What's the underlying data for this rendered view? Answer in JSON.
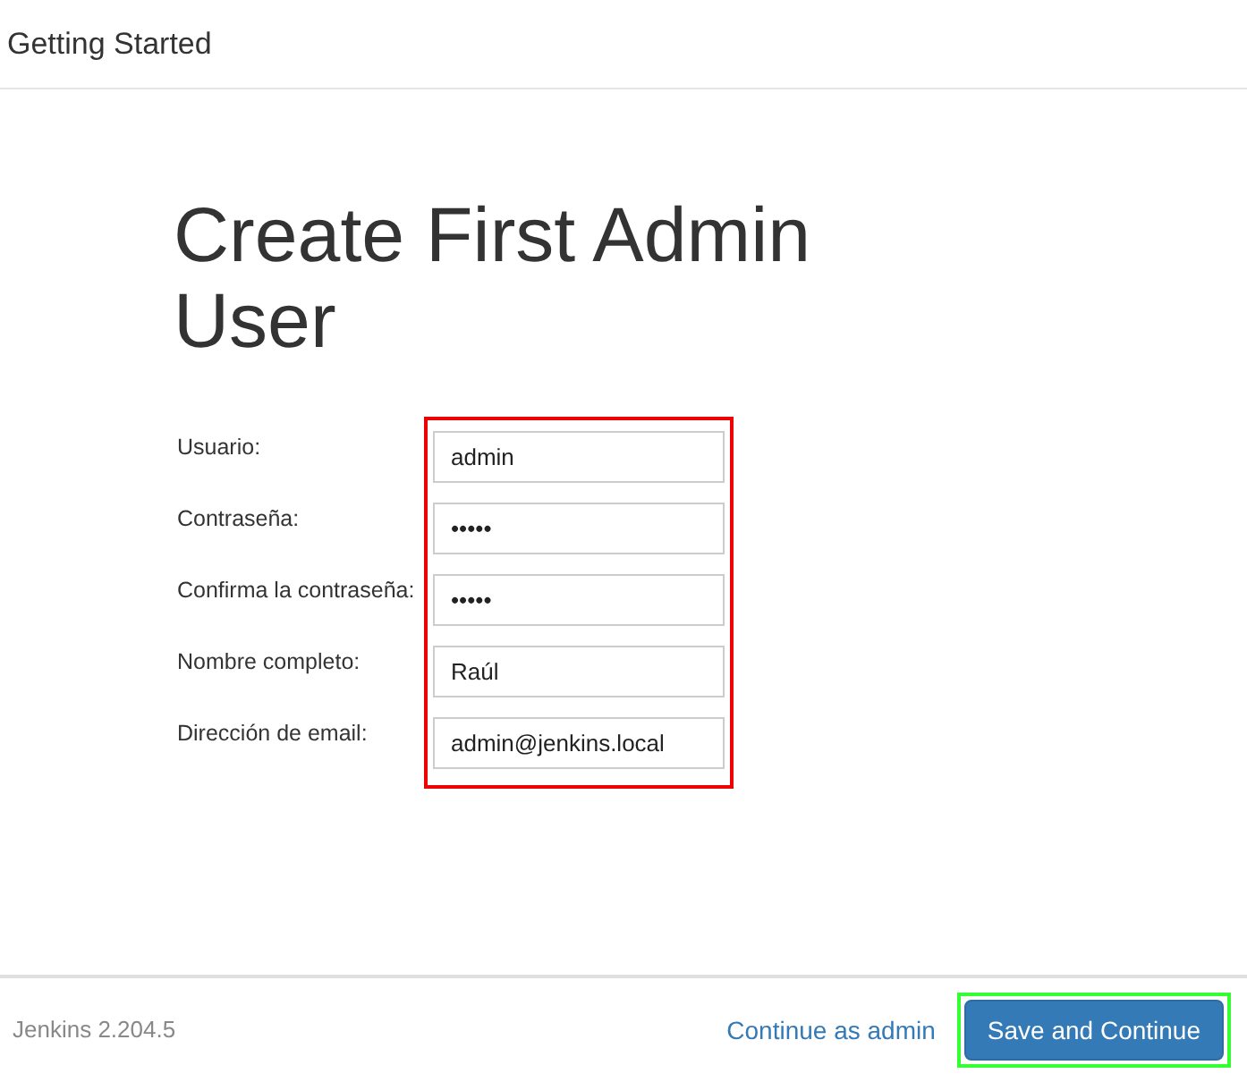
{
  "header": {
    "title": "Getting Started"
  },
  "heading": "Create First Admin User",
  "form": {
    "fields": [
      {
        "label": "Usuario:",
        "value": "admin"
      },
      {
        "label": "Contraseña:",
        "value": "•••••"
      },
      {
        "label": "Confirma la contraseña:",
        "value": "•••••"
      },
      {
        "label": "Nombre completo:",
        "value": "Raúl"
      },
      {
        "label": "Dirección de email:",
        "value": "admin@jenkins.local"
      }
    ]
  },
  "footer": {
    "version": "Jenkins 2.204.5",
    "link": "Continue as admin",
    "button": "Save and Continue"
  }
}
